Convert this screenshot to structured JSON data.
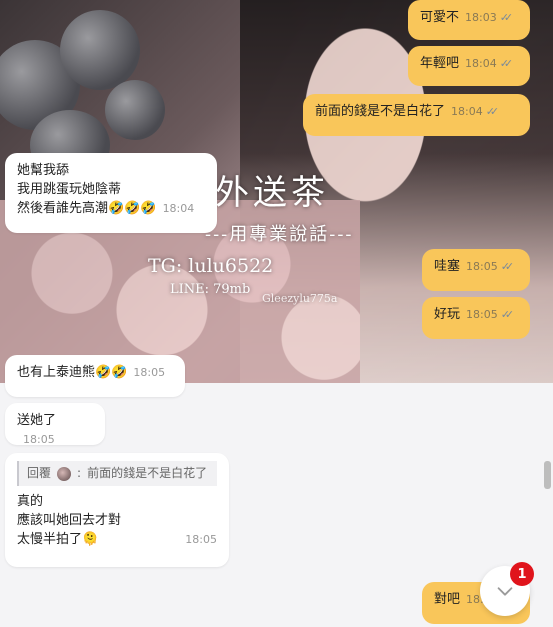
{
  "watermark": {
    "title": "外送茶",
    "subtitle": "---用專業說話---",
    "tg": "TG: lulu6522",
    "line": "LINE: 79mb",
    "handle": "Gleezylu775a"
  },
  "messages": [
    {
      "dir": "out",
      "text": "可愛不",
      "time": "18:03"
    },
    {
      "dir": "out",
      "text": "年輕吧",
      "time": "18:04"
    },
    {
      "dir": "out",
      "text": "前面的錢是不是白花了",
      "time": "18:04"
    },
    {
      "dir": "in",
      "lines": [
        "她幫我舔",
        "我用跳蛋玩她陰蒂",
        "然後看誰先高潮🤣🤣🤣"
      ],
      "time": "18:04"
    },
    {
      "dir": "out",
      "text": "哇塞",
      "time": "18:05"
    },
    {
      "dir": "out",
      "text": "好玩",
      "time": "18:05"
    },
    {
      "dir": "in",
      "text": "也有上泰迪熊🤣🤣",
      "time": "18:05"
    },
    {
      "dir": "in",
      "text": "送她了",
      "time": "18:05"
    },
    {
      "dir": "in",
      "reply_label": "回覆",
      "reply_sep": ":",
      "reply_text": "前面的錢是不是白花了",
      "lines": [
        "真的",
        "應該叫她回去才對",
        "太慢半拍了🫠"
      ],
      "time": "18:05"
    },
    {
      "dir": "out",
      "text": "對吧",
      "time": "18:05"
    }
  ],
  "unread_badge": "1",
  "colors": {
    "outgoing": "#f9c65a",
    "incoming": "#ffffff",
    "badge": "#e0141c"
  }
}
